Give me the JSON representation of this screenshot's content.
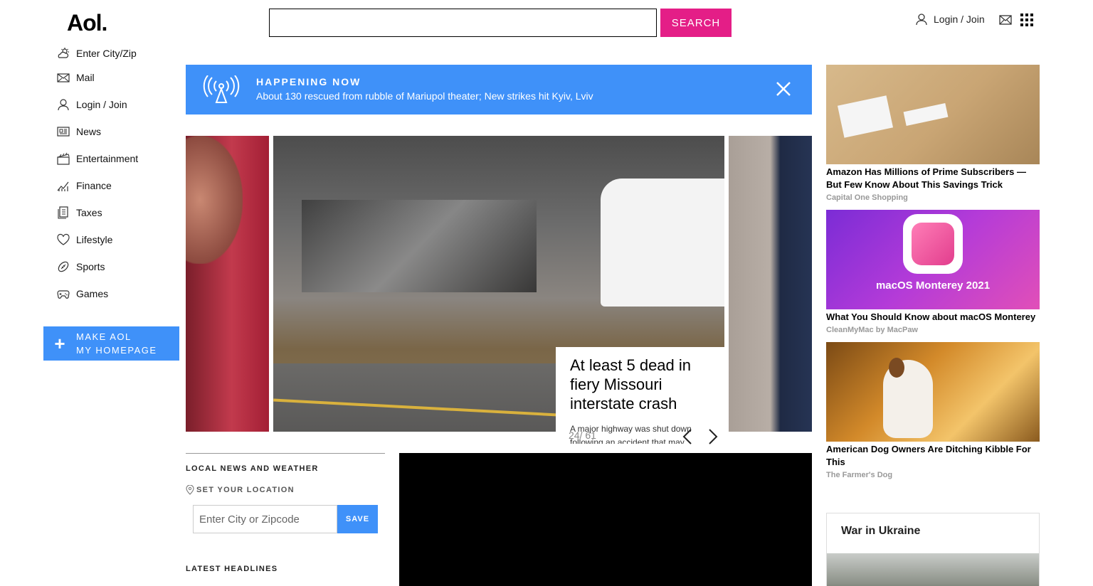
{
  "header": {
    "logo": "Aol.",
    "search_placeholder": "",
    "search_button": "SEARCH",
    "login_label": "Login / Join"
  },
  "sidebar": {
    "items": [
      {
        "label": "Enter City/Zip",
        "icon": "weather-icon"
      },
      {
        "label": "Mail",
        "icon": "mail-icon"
      },
      {
        "label": "Login / Join",
        "icon": "user-icon"
      },
      {
        "label": "News",
        "icon": "news-icon"
      },
      {
        "label": "Entertainment",
        "icon": "clapperboard-icon"
      },
      {
        "label": "Finance",
        "icon": "finance-chart-icon"
      },
      {
        "label": "Taxes",
        "icon": "taxes-document-icon"
      },
      {
        "label": "Lifestyle",
        "icon": "heart-icon"
      },
      {
        "label": "Sports",
        "icon": "football-icon"
      },
      {
        "label": "Games",
        "icon": "gamepad-icon"
      }
    ],
    "make_homepage_line1": "MAKE AOL",
    "make_homepage_line2": "MY HOMEPAGE"
  },
  "happening": {
    "title": "HAPPENING NOW",
    "text": "About 130 rescued from rubble of Mariupol theater; New strikes hit Kyiv, Lviv"
  },
  "carousel": {
    "title": "At least 5 dead in fiery Missouri interstate crash",
    "subtitle": "A major highway was shut down following an accident that may",
    "counter": "24/ 61"
  },
  "local": {
    "heading": "LOCAL NEWS AND WEATHER",
    "set_location": "SET YOUR LOCATION",
    "city_placeholder": "Enter City or Zipcode",
    "save": "SAVE",
    "latest_heading": "LATEST HEADLINES"
  },
  "ads": [
    {
      "title": "Amazon Has Millions of Prime Subscribers — But Few Know About This Savings Trick",
      "source": "Capital One Shopping"
    },
    {
      "title": "What You Should Know about macOS Monterey",
      "source": "CleanMyMac by MacPaw",
      "image_text": "macOS Monterey 2021"
    },
    {
      "title": "American Dog Owners Are Ditching Kibble For This",
      "source": "The Farmer's Dog"
    }
  ],
  "war": {
    "title": "War in Ukraine"
  },
  "colors": {
    "accent_pink": "#e41e87",
    "accent_blue": "#3f91f9"
  }
}
